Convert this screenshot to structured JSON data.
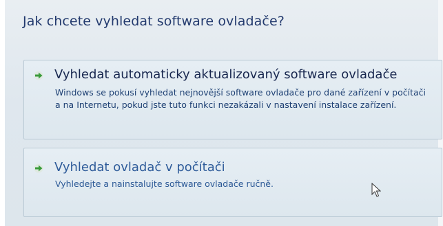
{
  "dialog": {
    "heading": "Jak chcete vyhledat software ovladače?"
  },
  "options": [
    {
      "title": "Vyhledat automaticky aktualizovaný software ovladače",
      "description": "Windows se pokusí vyhledat nejnovější software ovladače pro dané zařízení v počítači a na Internetu, pokud jste tuto funkci nezakázali v nastavení instalace zařízení.",
      "icon": "green-arrow-icon"
    },
    {
      "title": "Vyhledat ovladač v počítači",
      "description": "Vyhledejte a nainstalujte software ovladače ručně.",
      "icon": "green-arrow-icon"
    }
  ],
  "colors": {
    "heading": "#233a6e",
    "link_title": "#17264e",
    "link_title_hover": "#2f5c9a",
    "arrow": "#3a9b3a",
    "panel_border": "#b9c9d4"
  },
  "cursor": "mouse-pointer-icon"
}
